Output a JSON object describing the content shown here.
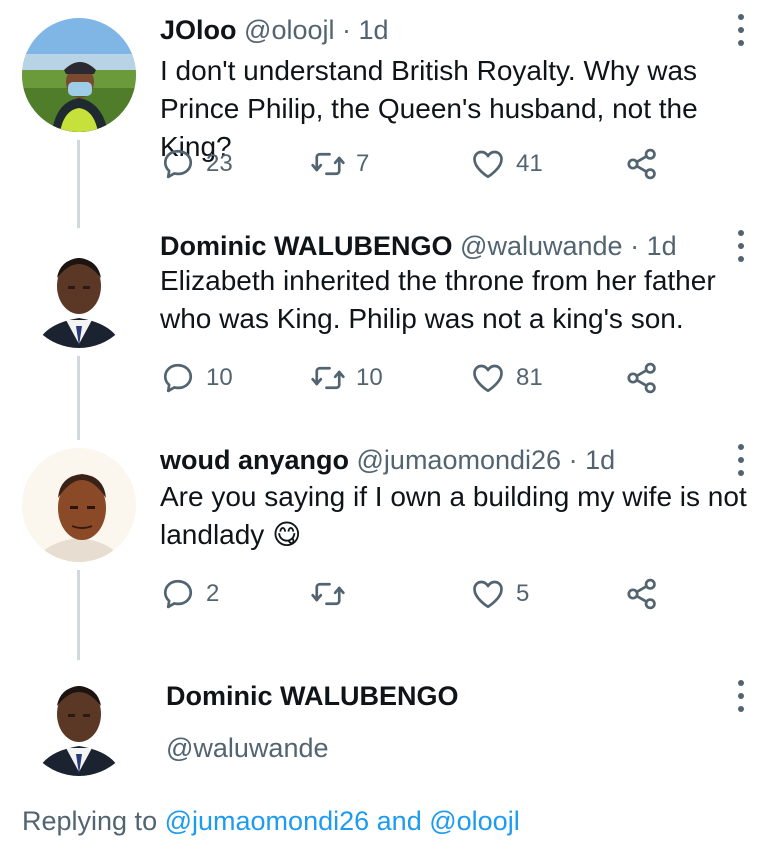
{
  "tweets": [
    {
      "name": "JOloo",
      "handle": "@oloojl",
      "sep": "·",
      "time": "1d",
      "text": "I don't understand British Royalty. Why was Prince Philip, the Queen's husband, not the King?",
      "reply_count": "23",
      "retweet_count": "7",
      "like_count": "41"
    },
    {
      "name": "Dominic WALUBENGO",
      "handle": "@waluwande",
      "sep": "·",
      "time": "1d",
      "text": "Elizabeth inherited the throne from her father who was King. Philip was not a king's son.",
      "reply_count": "10",
      "retweet_count": "10",
      "like_count": "81"
    },
    {
      "name": "woud anyango",
      "handle": "@jumaomondi26",
      "sep": "·",
      "time": "1d",
      "text": "Are you saying if I own a building my wife is not landlady",
      "emoji": "😋",
      "reply_count": "2",
      "retweet_count": "",
      "like_count": "5"
    }
  ],
  "focused": {
    "name": "Dominic WALUBENGO",
    "handle": "@waluwande"
  },
  "replying": {
    "prefix": "Replying to",
    "user1": "@jumaomondi26",
    "and": "and",
    "user2": "@oloojl"
  },
  "icons": {
    "reply": "reply-icon",
    "retweet": "retweet-icon",
    "like": "heart-icon",
    "share": "share-icon",
    "more": "more-vertical-icon"
  },
  "colors": {
    "name": "#0f1419",
    "secondary": "#536471",
    "link": "#1d9bf0",
    "thread_line": "#cfd9de"
  }
}
